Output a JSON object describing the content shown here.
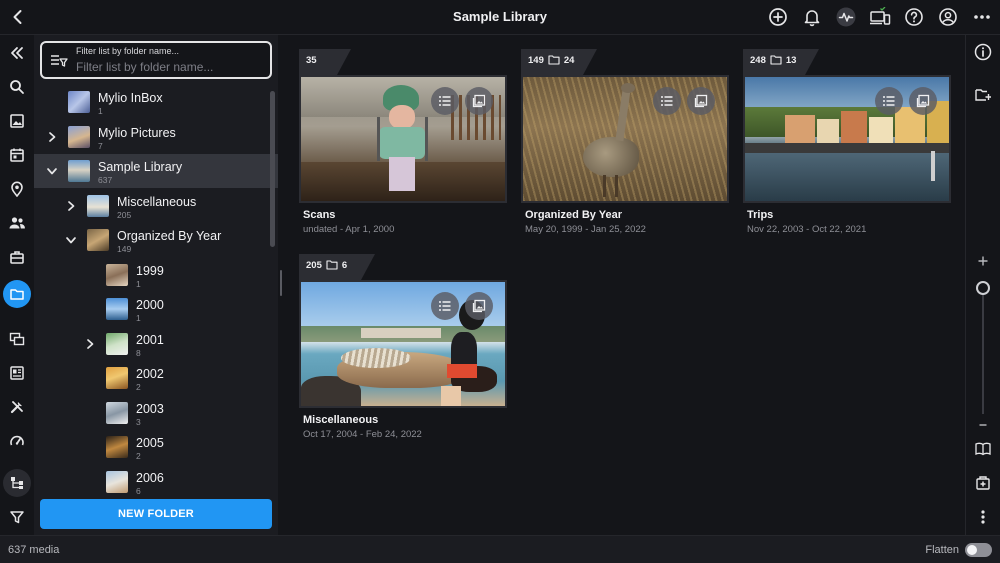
{
  "header": {
    "title": "Sample Library"
  },
  "filter": {
    "label": "Filter list by folder name...",
    "placeholder": "Filter list by folder name..."
  },
  "tree": [
    {
      "name": "Mylio InBox",
      "count": "1",
      "level": 0,
      "expand": "none",
      "selected": false,
      "thumb": "thumb-inbox"
    },
    {
      "name": "Mylio Pictures",
      "count": "7",
      "level": 0,
      "expand": "collapsed",
      "selected": false,
      "thumb": "thumb-pictures"
    },
    {
      "name": "Sample Library",
      "count": "637",
      "level": 0,
      "expand": "expanded",
      "selected": true,
      "thumb": "thumb-sample"
    },
    {
      "name": "Miscellaneous",
      "count": "205",
      "level": 1,
      "expand": "collapsed",
      "selected": false,
      "thumb": "thumb-misc"
    },
    {
      "name": "Organized By Year",
      "count": "149",
      "level": 1,
      "expand": "expanded",
      "selected": false,
      "thumb": "thumb-year"
    },
    {
      "name": "1999",
      "count": "1",
      "level": 2,
      "expand": "none",
      "selected": false,
      "thumb": "thumb-1999"
    },
    {
      "name": "2000",
      "count": "1",
      "level": 2,
      "expand": "none",
      "selected": false,
      "thumb": "thumb-2000"
    },
    {
      "name": "2001",
      "count": "8",
      "level": 2,
      "expand": "collapsed",
      "selected": false,
      "thumb": "thumb-2001"
    },
    {
      "name": "2002",
      "count": "2",
      "level": 2,
      "expand": "none",
      "selected": false,
      "thumb": "thumb-2002"
    },
    {
      "name": "2003",
      "count": "3",
      "level": 2,
      "expand": "none",
      "selected": false,
      "thumb": "thumb-2003"
    },
    {
      "name": "2005",
      "count": "2",
      "level": 2,
      "expand": "none",
      "selected": false,
      "thumb": "thumb-2005"
    },
    {
      "name": "2006",
      "count": "6",
      "level": 2,
      "expand": "none",
      "selected": false,
      "thumb": "thumb-2006"
    }
  ],
  "new_folder_label": "NEW FOLDER",
  "cards": [
    {
      "title": "Scans",
      "date": "undated - Apr 1, 2000",
      "media_count": "35",
      "folder_count": "",
      "image": "scene-playground"
    },
    {
      "title": "Organized By Year",
      "date": "May 20, 1999 - Jan 25, 2022",
      "media_count": "149",
      "folder_count": "24",
      "image": "scene-bird"
    },
    {
      "title": "Trips",
      "date": "Nov 22, 2003 - Oct 22, 2021",
      "media_count": "248",
      "folder_count": "13",
      "image": "scene-lakeside"
    },
    {
      "title": "Miscellaneous",
      "date": "Oct 17, 2004 - Feb 24, 2022",
      "media_count": "205",
      "folder_count": "6",
      "image": "scene-beach-horse"
    }
  ],
  "status": {
    "media_count": "637 media",
    "flatten_label": "Flatten",
    "flatten_on": false
  },
  "colors": {
    "accent": "#2196f3",
    "background": "#141519",
    "panel": "#1b1c21",
    "selected_row": "#34363d"
  }
}
